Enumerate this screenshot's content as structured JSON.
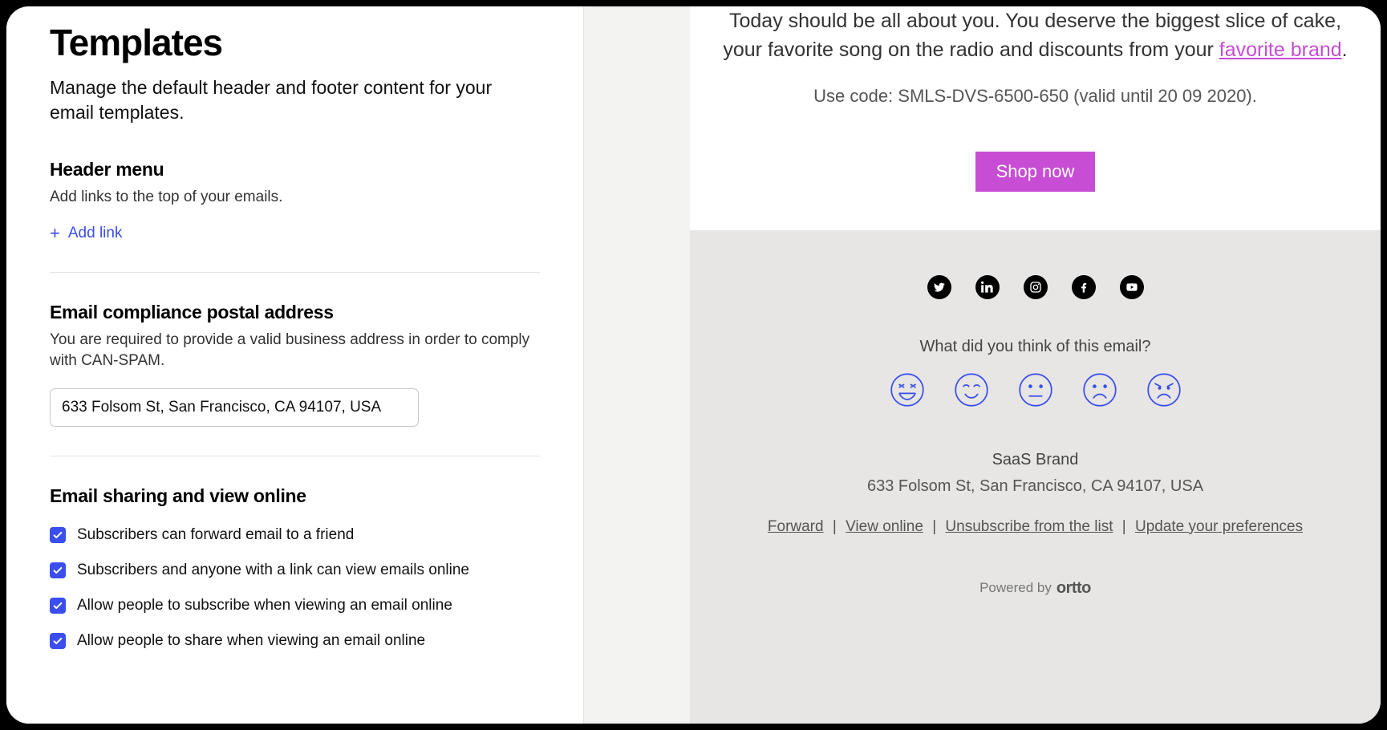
{
  "left": {
    "title": "Templates",
    "description": "Manage the default header and footer content for your email templates.",
    "header_menu": {
      "title": "Header menu",
      "description": "Add links to the top of your emails.",
      "add_link_label": "Add link"
    },
    "compliance": {
      "title": "Email compliance postal address",
      "description": "You are required to provide a valid business address in order to comply with CAN-SPAM.",
      "address_value": "633 Folsom St, San Francisco, CA 94107, USA"
    },
    "sharing": {
      "title": "Email sharing and view online",
      "options": [
        "Subscribers can forward email to a friend",
        "Subscribers and anyone with a link can view emails online",
        "Allow people to subscribe when viewing an email online",
        "Allow people to share when viewing an email online"
      ]
    }
  },
  "preview": {
    "body_line": "Today should be all about you. You deserve the biggest slice of cake, your favorite song on the radio and discounts from your ",
    "brand_link_text": "favorite brand",
    "body_end": ".",
    "code_line": "Use code: SMLS-DVS-6500-650 (valid until 20 09 2020).",
    "cta_label": "Shop now",
    "survey_question": "What did you think of this email?",
    "brand_name": "SaaS Brand",
    "brand_address": "633 Folsom St, San Francisco, CA 94107, USA",
    "footer_links": {
      "forward": "Forward",
      "view_online": "View online",
      "unsubscribe": "Unsubscribe from the list",
      "update_prefs": "Update your preferences"
    },
    "powered_by_prefix": "Powered by",
    "powered_by_brand": "ortto"
  }
}
